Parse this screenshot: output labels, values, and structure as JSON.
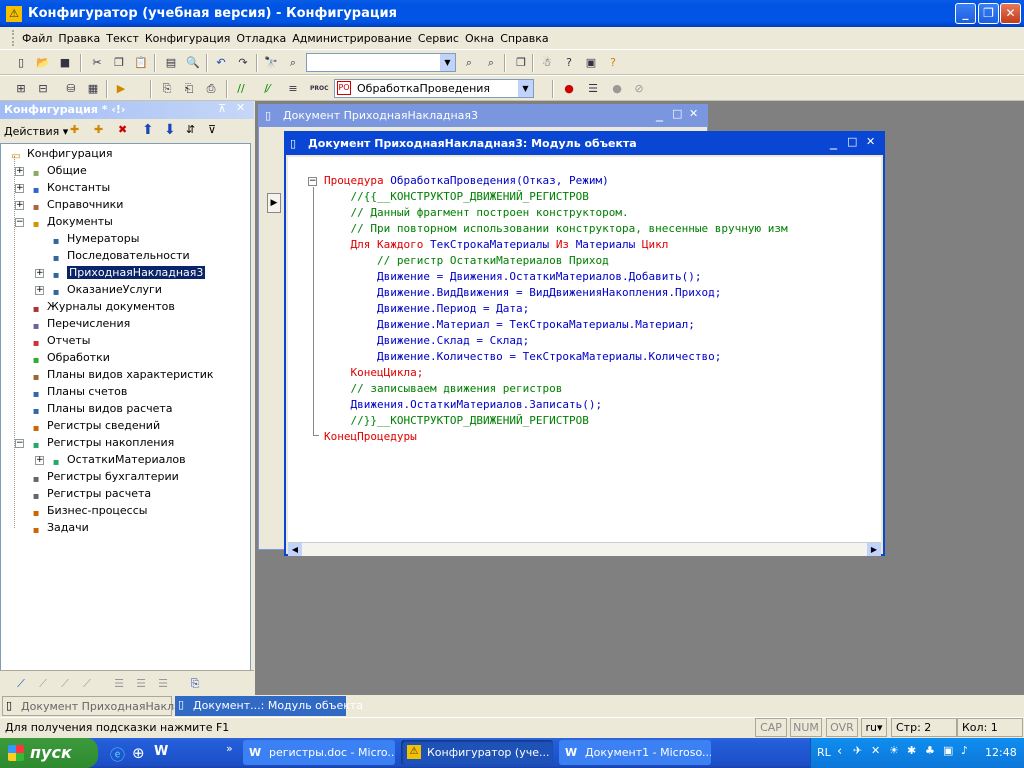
{
  "app": {
    "title": "Конфигуратор (учебная версия) - Конфигурация",
    "min": "_",
    "max": "❐",
    "close": "✕"
  },
  "menu": [
    "Файл",
    "Правка",
    "Текст",
    "Конфигурация",
    "Отладка",
    "Администрирование",
    "Сервис",
    "Окна",
    "Справка"
  ],
  "toolbar": {
    "procedure_select": "ОбработкаПроведения",
    "proc_label": "PROC"
  },
  "config_panel": {
    "title": "Конфигурация * ‹!›",
    "actions_label": "Действия",
    "items": [
      {
        "label": "Конфигурация",
        "icon": "config-icon"
      },
      {
        "label": "Общие",
        "icon": "common-icon"
      },
      {
        "label": "Константы",
        "icon": "constants-icon"
      },
      {
        "label": "Справочники",
        "icon": "catalogs-icon"
      },
      {
        "label": "Документы",
        "icon": "documents-folder-icon"
      },
      {
        "label": "Нумераторы",
        "icon": "numerators-icon"
      },
      {
        "label": "Последовательности",
        "icon": "sequences-icon"
      },
      {
        "label": "ПриходнаяНакладная3",
        "icon": "document-icon"
      },
      {
        "label": "ОказаниеУслуги",
        "icon": "document-icon"
      },
      {
        "label": "Журналы документов",
        "icon": "journals-icon"
      },
      {
        "label": "Перечисления",
        "icon": "enums-icon"
      },
      {
        "label": "Отчеты",
        "icon": "reports-icon"
      },
      {
        "label": "Обработки",
        "icon": "dataprocessors-icon"
      },
      {
        "label": "Планы видов характеристик",
        "icon": "chart-char-icon"
      },
      {
        "label": "Планы счетов",
        "icon": "chart-accounts-icon"
      },
      {
        "label": "Планы видов расчета",
        "icon": "chart-calc-icon"
      },
      {
        "label": "Регистры сведений",
        "icon": "info-registers-icon"
      },
      {
        "label": "Регистры накопления",
        "icon": "accum-registers-icon"
      },
      {
        "label": "ОстаткиМатериалов",
        "icon": "register-icon"
      },
      {
        "label": "Регистры бухгалтерии",
        "icon": "acc-registers-icon"
      },
      {
        "label": "Регистры расчета",
        "icon": "calc-registers-icon"
      },
      {
        "label": "Бизнес-процессы",
        "icon": "bp-icon"
      },
      {
        "label": "Задачи",
        "icon": "tasks-icon"
      }
    ]
  },
  "doc_window": {
    "title": "Документ ПриходнаяНакладная3"
  },
  "module_window": {
    "title": "Документ ПриходнаяНакладная3: Модуль объекта",
    "lines": [
      [
        {
          "t": "Процедура ",
          "c": "kw"
        },
        {
          "t": "ОбработкаПроведения(Отказ, Режим)",
          "c": "id"
        }
      ],
      [
        {
          "t": "    //{{__КОНСТРУКТОР_ДВИЖЕНИЙ_РЕГИСТРОВ",
          "c": "cm"
        }
      ],
      [
        {
          "t": "    // Данный фрагмент построен конструктором.",
          "c": "cm"
        }
      ],
      [
        {
          "t": "    // При повторном использовании конструктора, внесенные вручную изм",
          "c": "cm"
        }
      ],
      [
        {
          "t": "    Для Каждого ",
          "c": "kw"
        },
        {
          "t": "ТекСтрокаМатериалы ",
          "c": "id"
        },
        {
          "t": "Из ",
          "c": "kw"
        },
        {
          "t": "Материалы ",
          "c": "id"
        },
        {
          "t": "Цикл",
          "c": "kw"
        }
      ],
      [
        {
          "t": "        // регистр ОстаткиМатериалов Приход",
          "c": "cm"
        }
      ],
      [
        {
          "t": "        Движение = Движения.ОстаткиМатериалов.Добавить();",
          "c": "id"
        }
      ],
      [
        {
          "t": "        Движение.ВидДвижения = ВидДвиженияНакопления.Приход;",
          "c": "id"
        }
      ],
      [
        {
          "t": "        Движение.Период = Дата;",
          "c": "id"
        }
      ],
      [
        {
          "t": "        Движение.Материал = ТекСтрокаМатериалы.Материал;",
          "c": "id"
        }
      ],
      [
        {
          "t": "        Движение.Склад = Склад;",
          "c": "id"
        }
      ],
      [
        {
          "t": "        Движение.Количество = ТекСтрокаМатериалы.Количество;",
          "c": "id"
        }
      ],
      [
        {
          "t": "    КонецЦикла;",
          "c": "kw"
        }
      ],
      [
        {
          "t": "    // записываем движения регистров",
          "c": "cm"
        }
      ],
      [
        {
          "t": "    Движения.ОстаткиМатериалов.Записать();",
          "c": "id"
        }
      ],
      [
        {
          "t": "    //}}__КОНСТРУКТОР_ДВИЖЕНИЙ_РЕГИСТРОВ",
          "c": "cm"
        }
      ],
      [
        {
          "t": "КонецПроцедуры",
          "c": "kw"
        }
      ]
    ]
  },
  "window_tabs": [
    "Документ ПриходнаяНакла...",
    "Документ...: Модуль объекта"
  ],
  "status": {
    "hint": "Для получения подсказки нажмите F1",
    "cap": "CAP",
    "num": "NUM",
    "ovr": "OVR",
    "lang": "ru",
    "row": "Стр: 2",
    "col": "Кол: 1"
  },
  "taskbar": {
    "start": "пуск",
    "tasks": [
      "регистры.doc - Micro...",
      "Конфигуратор (уче...",
      "Документ1 - Microso..."
    ],
    "lang": "RL",
    "clock": "12:48"
  }
}
